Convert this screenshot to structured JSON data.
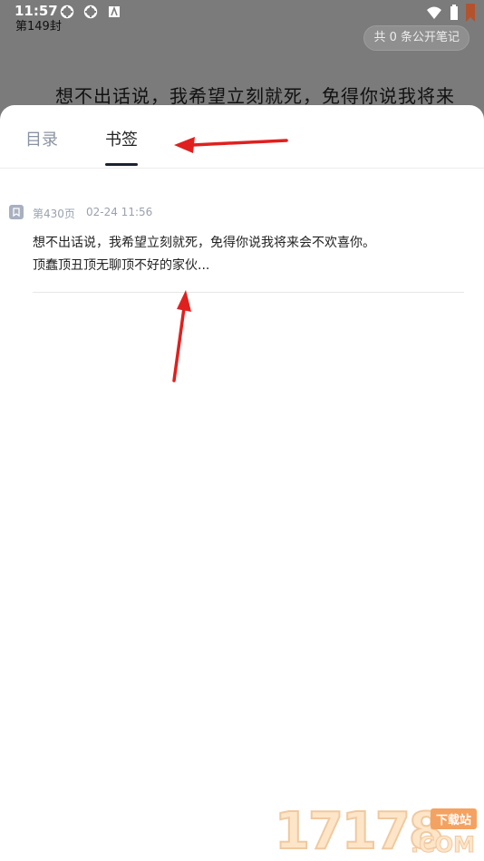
{
  "status_bar": {
    "time": "11:57",
    "icons": [
      "sync-icon",
      "sync-icon",
      "app-a-icon"
    ],
    "right_icons": [
      "wifi-icon",
      "battery-icon",
      "bookmark-flag-icon"
    ]
  },
  "reader": {
    "chapter": "第149封",
    "notes_pill": "共 0 条公开笔记",
    "text": "想不出话说，我希望立刻就死，免得你说我将来"
  },
  "tabs": [
    {
      "label": "目录",
      "active": false
    },
    {
      "label": "书签",
      "active": true
    }
  ],
  "bookmarks": [
    {
      "page": "第430页",
      "date": "02-24 11:56",
      "line1": "想不出话说，我希望立刻就死，免得你说我将来会不欢喜你。",
      "line2": "顶蠢顶丑顶无聊顶不好的家伙..."
    }
  ],
  "watermark": {
    "digits": "17178",
    "badge": "下载站",
    "suffix": ".COM"
  },
  "colors": {
    "annotation": "#e0201e",
    "tab_inactive": "#8a93a3",
    "tab_active": "#222222"
  }
}
